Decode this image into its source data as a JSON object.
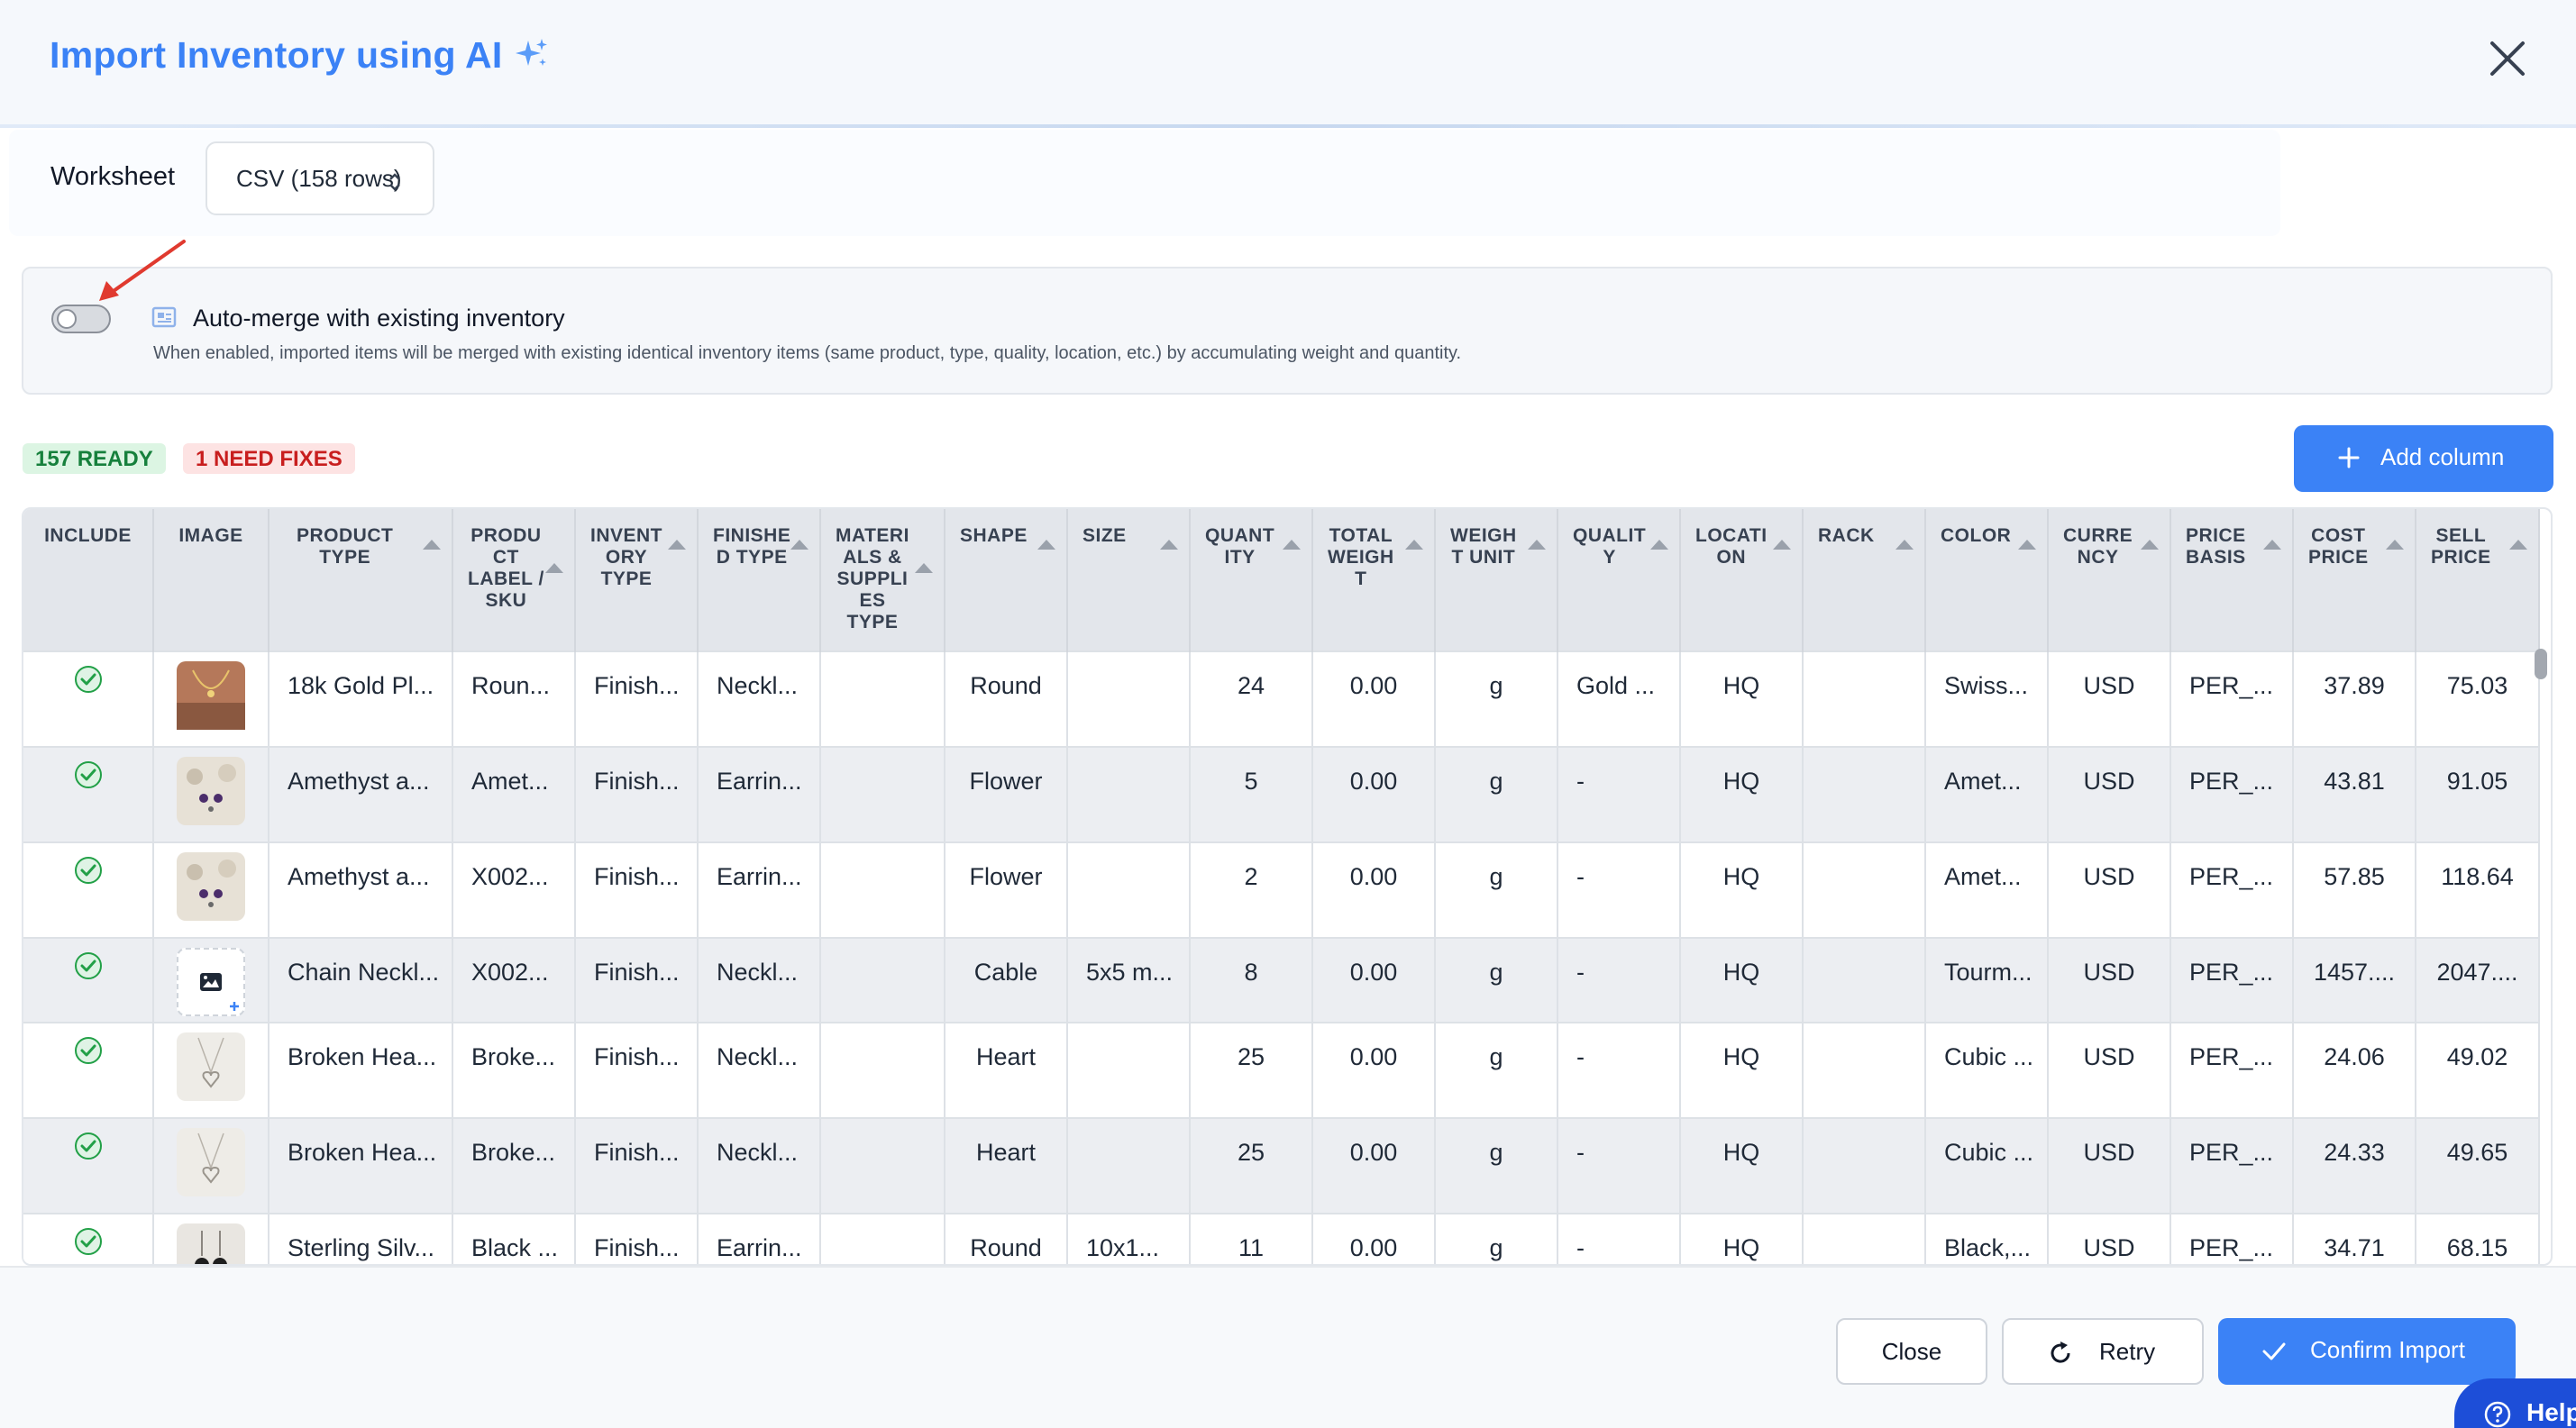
{
  "header": {
    "title": "Import Inventory using AI"
  },
  "worksheet": {
    "label": "Worksheet",
    "selected": "CSV (158 rows)"
  },
  "merge": {
    "title": "Auto-merge with existing inventory",
    "description": "When enabled, imported items will be merged with existing identical inventory items (same product, type, quality, location, etc.) by accumulating weight and quantity.",
    "enabled": false
  },
  "status": {
    "ready": "157 READY",
    "need_fixes": "1 NEED FIXES"
  },
  "add_column": {
    "label": "Add column"
  },
  "table": {
    "headers": [
      [
        "INCLUDE"
      ],
      [
        "IMAGE"
      ],
      [
        "PRODUCT",
        "TYPE"
      ],
      [
        "PRODU",
        "CT",
        "LABEL /",
        "SKU"
      ],
      [
        "INVENT",
        "ORY",
        "TYPE"
      ],
      [
        "FINISHE",
        "D TYPE"
      ],
      [
        "MATERI",
        "ALS &",
        "SUPPLI",
        "ES",
        "TYPE"
      ],
      [
        "SHAPE"
      ],
      [
        "SIZE"
      ],
      [
        "QUANT",
        "ITY"
      ],
      [
        "TOTAL",
        "WEIGH",
        "T"
      ],
      [
        "WEIGH",
        "T UNIT"
      ],
      [
        "QUALIT",
        "Y"
      ],
      [
        "LOCATI",
        "ON"
      ],
      [
        "RACK"
      ],
      [
        "COLOR"
      ],
      [
        "CURRE",
        "NCY"
      ],
      [
        "PRICE",
        "BASIS"
      ],
      [
        "COST",
        "PRICE"
      ],
      [
        "SELL",
        "PRICE"
      ]
    ],
    "rows": [
      {
        "image": "gold-necklace-photo",
        "product_type": "18k Gold Pl...",
        "sku": "Roun...",
        "inventory_type": "Finish...",
        "finished_type": "Neckl...",
        "materials": "",
        "shape": "Round",
        "size": "",
        "quantity": "24",
        "total_weight": "0.00",
        "weight_unit": "g",
        "quality": "Gold ...",
        "location": "HQ",
        "rack": "",
        "color": "Swiss...",
        "currency": "USD",
        "price_basis": "PER_...",
        "cost_price": "37.89",
        "sell_price": "75.03"
      },
      {
        "image": "amethyst-earring-photo",
        "product_type": "Amethyst a...",
        "sku": "Amet...",
        "inventory_type": "Finish...",
        "finished_type": "Earrin...",
        "materials": "",
        "shape": "Flower",
        "size": "",
        "quantity": "5",
        "total_weight": "0.00",
        "weight_unit": "g",
        "quality": "-",
        "location": "HQ",
        "rack": "",
        "color": "Amet...",
        "currency": "USD",
        "price_basis": "PER_...",
        "cost_price": "43.81",
        "sell_price": "91.05"
      },
      {
        "image": "amethyst-earring-photo",
        "product_type": "Amethyst a...",
        "sku": "X002...",
        "inventory_type": "Finish...",
        "finished_type": "Earrin...",
        "materials": "",
        "shape": "Flower",
        "size": "",
        "quantity": "2",
        "total_weight": "0.00",
        "weight_unit": "g",
        "quality": "-",
        "location": "HQ",
        "rack": "",
        "color": "Amet...",
        "currency": "USD",
        "price_basis": "PER_...",
        "cost_price": "57.85",
        "sell_price": "118.64"
      },
      {
        "image": "add-image-placeholder",
        "product_type": "Chain Neckl...",
        "sku": "X002...",
        "inventory_type": "Finish...",
        "finished_type": "Neckl...",
        "materials": "",
        "shape": "Cable",
        "size": "5x5 m...",
        "quantity": "8",
        "total_weight": "0.00",
        "weight_unit": "g",
        "quality": "-",
        "location": "HQ",
        "rack": "",
        "color": "Tourm...",
        "currency": "USD",
        "price_basis": "PER_...",
        "cost_price": "1457....",
        "sell_price": "2047...."
      },
      {
        "image": "heart-pendant-photo",
        "product_type": "Broken Hea...",
        "sku": "Broke...",
        "inventory_type": "Finish...",
        "finished_type": "Neckl...",
        "materials": "",
        "shape": "Heart",
        "size": "",
        "quantity": "25",
        "total_weight": "0.00",
        "weight_unit": "g",
        "quality": "-",
        "location": "HQ",
        "rack": "",
        "color": "Cubic ...",
        "currency": "USD",
        "price_basis": "PER_...",
        "cost_price": "24.06",
        "sell_price": "49.02"
      },
      {
        "image": "heart-pendant-photo",
        "product_type": "Broken Hea...",
        "sku": "Broke...",
        "inventory_type": "Finish...",
        "finished_type": "Neckl...",
        "materials": "",
        "shape": "Heart",
        "size": "",
        "quantity": "25",
        "total_weight": "0.00",
        "weight_unit": "g",
        "quality": "-",
        "location": "HQ",
        "rack": "",
        "color": "Cubic ...",
        "currency": "USD",
        "price_basis": "PER_...",
        "cost_price": "24.33",
        "sell_price": "49.65"
      },
      {
        "image": "black-earring-photo",
        "product_type": "Sterling Silv...",
        "sku": "Black ...",
        "inventory_type": "Finish...",
        "finished_type": "Earrin...",
        "materials": "",
        "shape": "Round",
        "size": "10x1...",
        "quantity": "11",
        "total_weight": "0.00",
        "weight_unit": "g",
        "quality": "-",
        "location": "HQ",
        "rack": "",
        "color": "Black,...",
        "currency": "USD",
        "price_basis": "PER_...",
        "cost_price": "34.71",
        "sell_price": "68.15"
      }
    ]
  },
  "footer": {
    "close": "Close",
    "retry": "Retry",
    "confirm": "Confirm Import"
  },
  "help": {
    "label": "Help"
  },
  "colors": {
    "accent": "#3b82f6",
    "ready_bg": "#dcf5e3",
    "fix_bg": "#fde3e3",
    "check": "#22a047",
    "arrow": "#e03a2f"
  }
}
